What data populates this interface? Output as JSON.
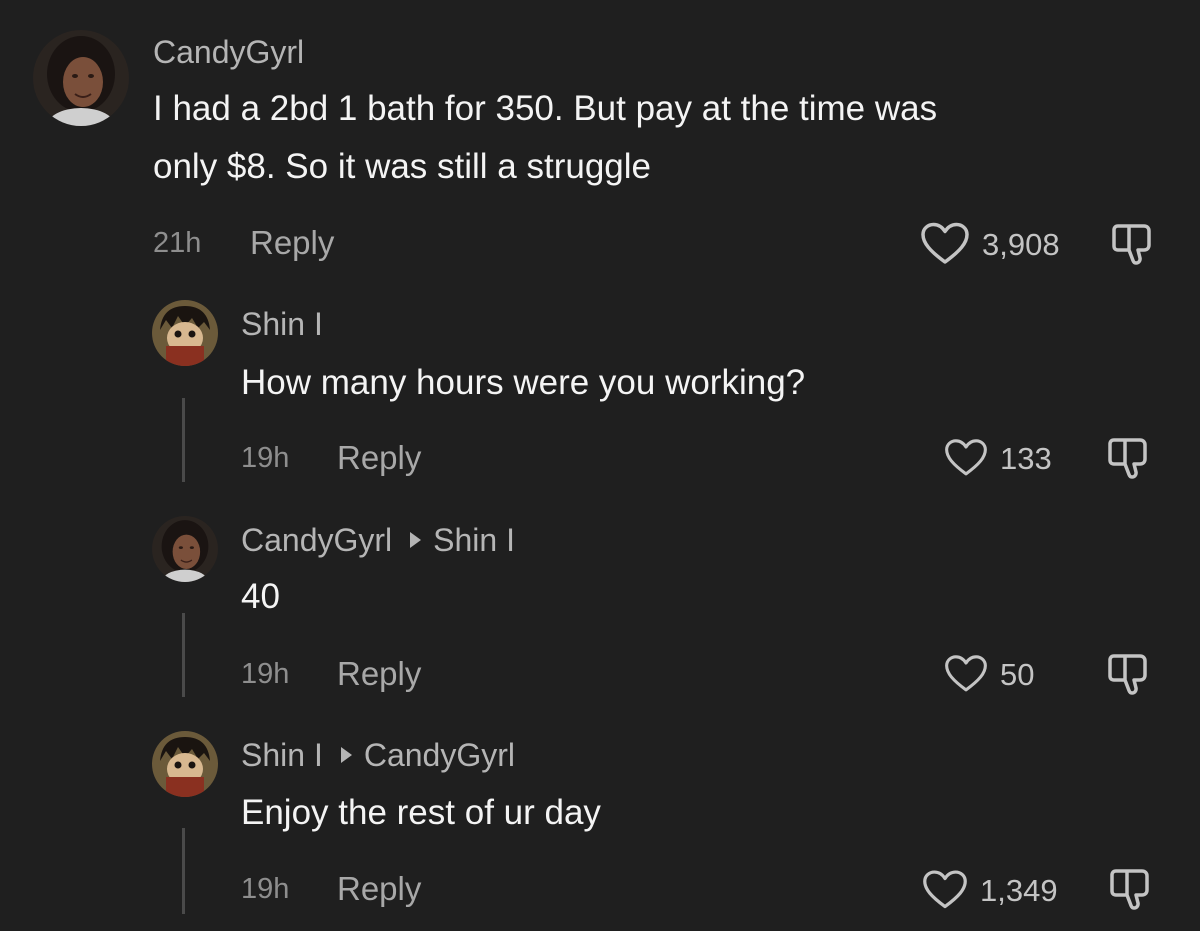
{
  "comments": [
    {
      "user": "CandyGyrl",
      "reply_to": "",
      "text_lines": [
        "I had a 2bd 1 bath for 350. But pay at the time was",
        "only $8. So it was still a struggle"
      ],
      "time": "21h",
      "reply_label": "Reply",
      "likes": "3,908"
    },
    {
      "user": "Shin I",
      "reply_to": "",
      "text_lines": [
        "How many hours were you working?"
      ],
      "time": "19h",
      "reply_label": "Reply",
      "likes": "133"
    },
    {
      "user": "CandyGyrl",
      "reply_to": "Shin I",
      "text_lines": [
        "40"
      ],
      "time": "19h",
      "reply_label": "Reply",
      "likes": "50"
    },
    {
      "user": "Shin I",
      "reply_to": "CandyGyrl",
      "text_lines": [
        "Enjoy the rest of ur day"
      ],
      "time": "19h",
      "reply_label": "Reply",
      "likes": "1,349"
    }
  ],
  "icons": {
    "like": "heart-outline-icon",
    "dislike": "thumbs-down-outline-icon"
  },
  "colors": {
    "background": "#1f1f1f",
    "username": "#b5b5b5",
    "text": "#f4f4f4",
    "meta": "#8e8e8e"
  }
}
